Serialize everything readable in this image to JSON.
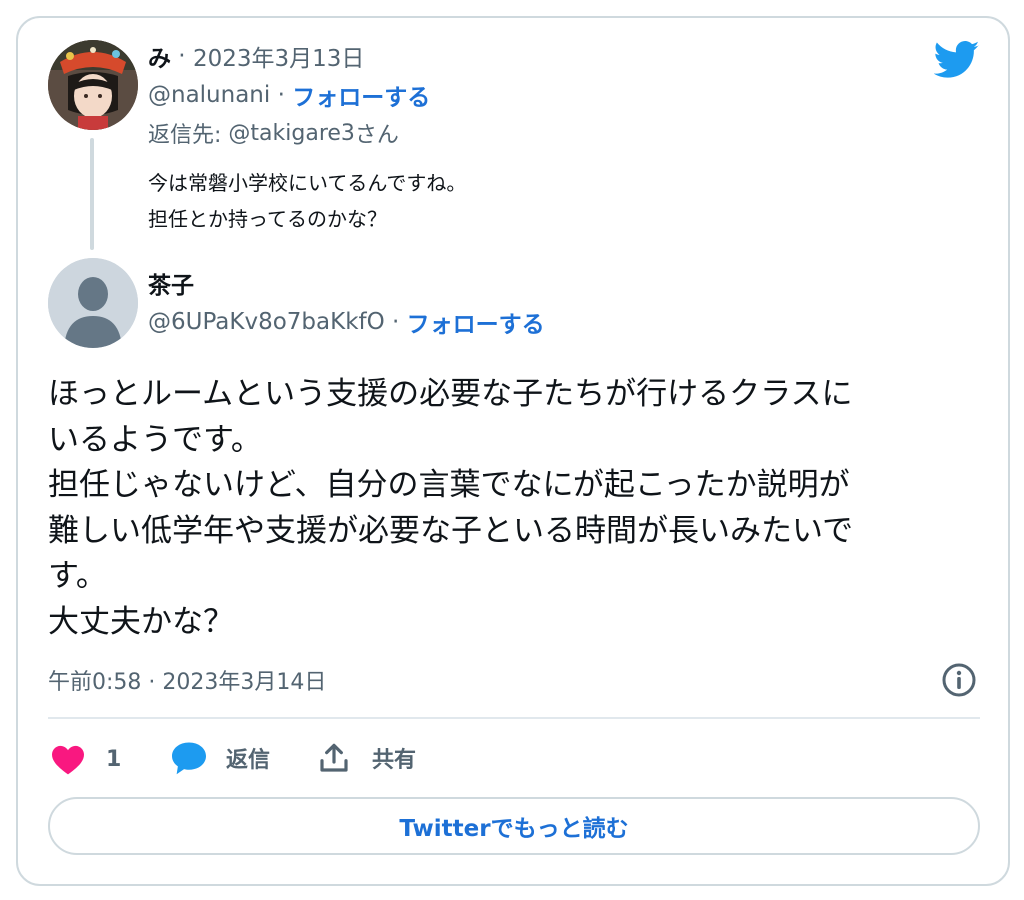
{
  "reply_tweet": {
    "author_name": "み",
    "date_sep": " · ",
    "date": "2023年3月13日",
    "handle": "@nalunani",
    "handle_sep": " · ",
    "follow_label": "フォローする",
    "reply_prefix": "返信先: ",
    "reply_to_handle": "@takigare3",
    "reply_suffix": "さん",
    "text_line1": "今は常磐小学校にいてるんですね。",
    "text_line2": "担任とか持ってるのかな？"
  },
  "main_tweet": {
    "author_name": "茶子",
    "handle": "@6UPaKv8o7baKkfO",
    "handle_sep": " · ",
    "follow_label": "フォローする",
    "text_lines": [
      "ほっとルームという支援の必要な子たちが行けるクラスに",
      "いるようです。",
      "担任じゃないけど、自分の言葉でなにが起こったか説明が",
      "難しい低学年や支援が必要な子といる時間が長いみたいで",
      "す。",
      "大丈夫かな？"
    ],
    "timestamp": "午前0:58 · 2023年3月14日"
  },
  "actions": {
    "like_count": "1",
    "reply_label": "返信",
    "share_label": "共有"
  },
  "more_button_label": "Twitterでもっと読む",
  "icons": {
    "twitter": "twitter-bird-icon",
    "info": "info-icon",
    "like": "heart-icon",
    "reply": "speech-bubble-icon",
    "share": "share-upload-icon"
  },
  "colors": {
    "twitter_blue": "#1d9bf0",
    "link_blue": "#1d70d6",
    "heart": "#f91880",
    "gray_text": "#536471",
    "border": "#cfd9de"
  }
}
